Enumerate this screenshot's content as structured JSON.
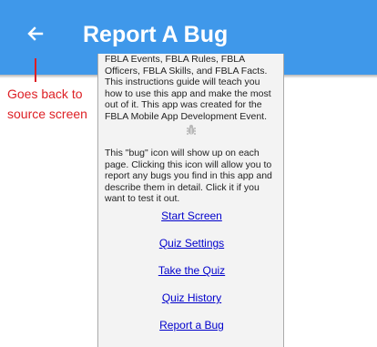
{
  "header": {
    "title": "Report A Bug",
    "background_color": "#3f98ea",
    "back_icon": "arrow-left-icon"
  },
  "annotation": {
    "text": "Goes back to source screen",
    "color": "#dd1f24"
  },
  "content": {
    "intro_text": "FBLA Events, FBLA Rules, FBLA Officers, FBLA Skills, and FBLA Facts. This instructions guide will teach you how to use this app and make the most out of it. This app was created for the FBLA Mobile App Development Event.",
    "bug_icon": "bug-icon",
    "bug_text": "This \"bug\" icon will show up on each page. Clicking this icon will allow you to report any bugs you find in this app and describe them in detail. Click it if you want to test it out.",
    "links": [
      {
        "label": "Start Screen"
      },
      {
        "label": "Quiz Settings"
      },
      {
        "label": "Take the Quiz"
      },
      {
        "label": "Quiz History"
      },
      {
        "label": "Report a Bug"
      }
    ]
  }
}
